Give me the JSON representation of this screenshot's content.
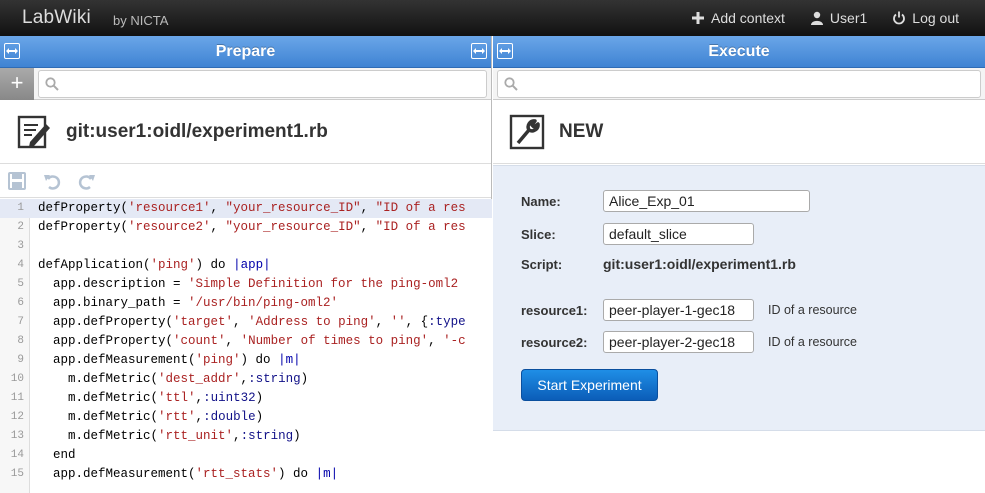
{
  "navbar": {
    "brand": "LabWiki",
    "byline": "by NICTA",
    "links": [
      {
        "label": "Add context",
        "icon": "plus-icon"
      },
      {
        "label": "User1",
        "icon": "user-icon"
      },
      {
        "label": "Log out",
        "icon": "power-icon"
      }
    ]
  },
  "prepare": {
    "header": "Prepare",
    "search_placeholder": "",
    "title": "git:user1:oidl/experiment1.rb",
    "code": [
      {
        "n": "1",
        "t": "defProperty('resource1', \"your_resource_ID\", \"ID of a res"
      },
      {
        "n": "2",
        "t": "defProperty('resource2', \"your_resource_ID\", \"ID of a res"
      },
      {
        "n": "3",
        "t": ""
      },
      {
        "n": "4",
        "t": "defApplication('ping') do |app|"
      },
      {
        "n": "5",
        "t": "  app.description = 'Simple Definition for the ping-oml2"
      },
      {
        "n": "6",
        "t": "  app.binary_path = '/usr/bin/ping-oml2'"
      },
      {
        "n": "7",
        "t": "  app.defProperty('target', 'Address to ping', '', {:type"
      },
      {
        "n": "8",
        "t": "  app.defProperty('count', 'Number of times to ping', '-c"
      },
      {
        "n": "9",
        "t": "  app.defMeasurement('ping') do |m|"
      },
      {
        "n": "10",
        "t": "    m.defMetric('dest_addr',:string)"
      },
      {
        "n": "11",
        "t": "    m.defMetric('ttl',:uint32)"
      },
      {
        "n": "12",
        "t": "    m.defMetric('rtt',:double)"
      },
      {
        "n": "13",
        "t": "    m.defMetric('rtt_unit',:string)"
      },
      {
        "n": "14",
        "t": "  end"
      },
      {
        "n": "15",
        "t": "  app.defMeasurement('rtt_stats') do |m|"
      }
    ]
  },
  "execute": {
    "header": "Execute",
    "search_placeholder": "",
    "title": "NEW",
    "form": {
      "name_label": "Name:",
      "name_value": "Alice_Exp_01",
      "slice_label": "Slice:",
      "slice_value": "default_slice",
      "script_label": "Script:",
      "script_value": "git:user1:oidl/experiment1.rb",
      "resource1_label": "resource1:",
      "resource1_value": "peer-player-1-gec18",
      "resource1_hint": "ID of a resource",
      "resource2_label": "resource2:",
      "resource2_value": "peer-player-2-gec18",
      "resource2_hint": "ID of a resource",
      "start_label": "Start Experiment"
    }
  },
  "colors": {
    "header_blue": "#4a8ed9",
    "button_blue": "#0b6fd0",
    "navbar": "#1f1f1f"
  }
}
